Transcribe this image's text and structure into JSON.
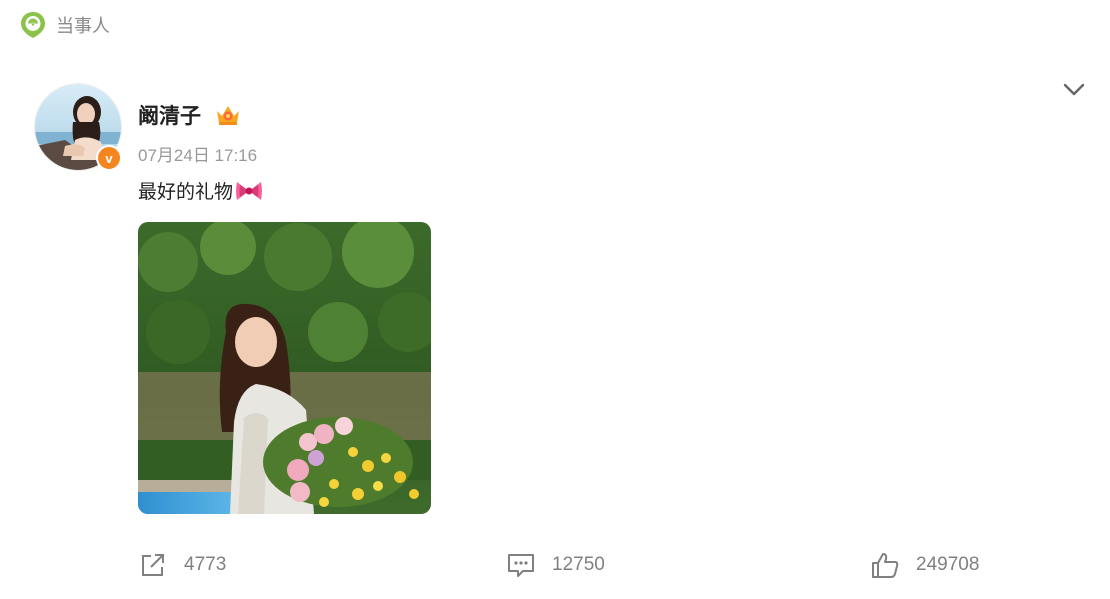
{
  "tag": {
    "label": "当事人",
    "icon": "location-chat-icon",
    "color": "#8bc34a"
  },
  "post": {
    "author": {
      "name": "阚清子",
      "badge_icon": "crown-icon",
      "verified_icon": "verified-v-icon",
      "verified_color": "#f5851f"
    },
    "timestamp": "07月24日 17:16",
    "text": "最好的礼物",
    "text_emoji": "bow-emoji-icon",
    "image": "photo-woman-holding-flowers"
  },
  "actions": {
    "share": {
      "icon": "share-icon",
      "count": "4773"
    },
    "comment": {
      "icon": "comment-icon",
      "count": "12750"
    },
    "like": {
      "icon": "thumbs-up-icon",
      "count": "249708"
    }
  },
  "menu": {
    "icon": "chevron-down-icon"
  }
}
